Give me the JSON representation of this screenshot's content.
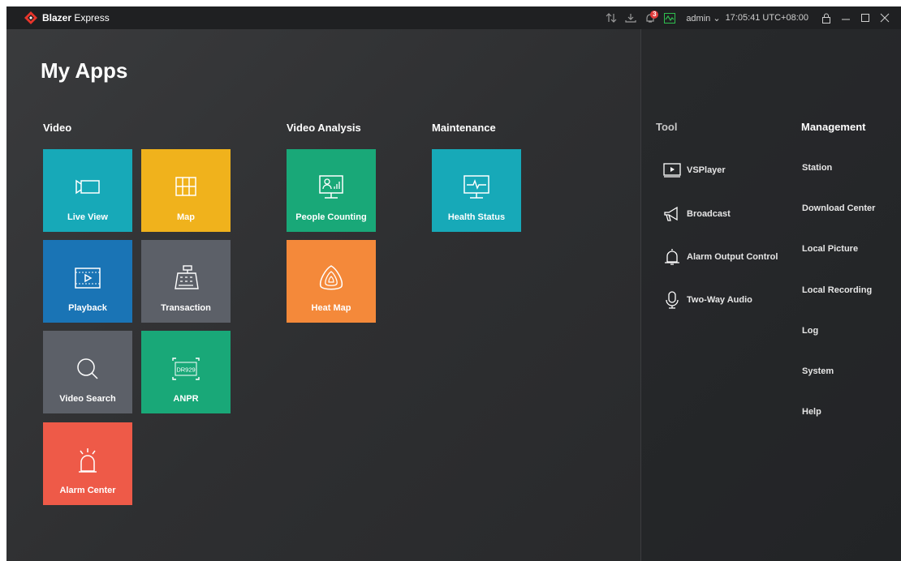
{
  "titlebar": {
    "app_name_bold": "Blazer",
    "app_name_rest": " Express",
    "alarm_count": "3",
    "user": "admin",
    "time": "17:05:41 UTC+08:00",
    "icons": [
      "transfer-icon",
      "download-icon",
      "alarm-icon",
      "performance-icon",
      "lock-icon",
      "minimize-icon",
      "maximize-icon",
      "close-icon"
    ]
  },
  "page_title": "My Apps",
  "sections": {
    "video": "Video",
    "video_analysis": "Video Analysis",
    "maintenance": "Maintenance"
  },
  "tiles": {
    "live_view": {
      "label": "Live View",
      "color": "#17a9b8"
    },
    "map": {
      "label": "Map",
      "color": "#f0b21c"
    },
    "playback": {
      "label": "Playback",
      "color": "#1a74b5"
    },
    "transaction": {
      "label": "Transaction",
      "color": "#5c6068"
    },
    "video_search": {
      "label": "Video Search",
      "color": "#5c6068"
    },
    "anpr": {
      "label": "ANPR",
      "color": "#19a878",
      "plate": "DR929"
    },
    "alarm_center": {
      "label": "Alarm Center",
      "color": "#ee5a48"
    },
    "people_counting": {
      "label": "People Counting",
      "color": "#19a878"
    },
    "heat_map": {
      "label": "Heat Map",
      "color": "#f4893a"
    },
    "health_status": {
      "label": "Health Status",
      "color": "#17a9b8"
    }
  },
  "tool": {
    "title": "Tool",
    "items": [
      "VSPlayer",
      "Broadcast",
      "Alarm Output Control",
      "Two-Way Audio"
    ]
  },
  "management": {
    "title": "Management",
    "items": [
      "Station",
      "Download Center",
      "Local Picture",
      "Local Recording",
      "Log",
      "System",
      "Help"
    ]
  }
}
